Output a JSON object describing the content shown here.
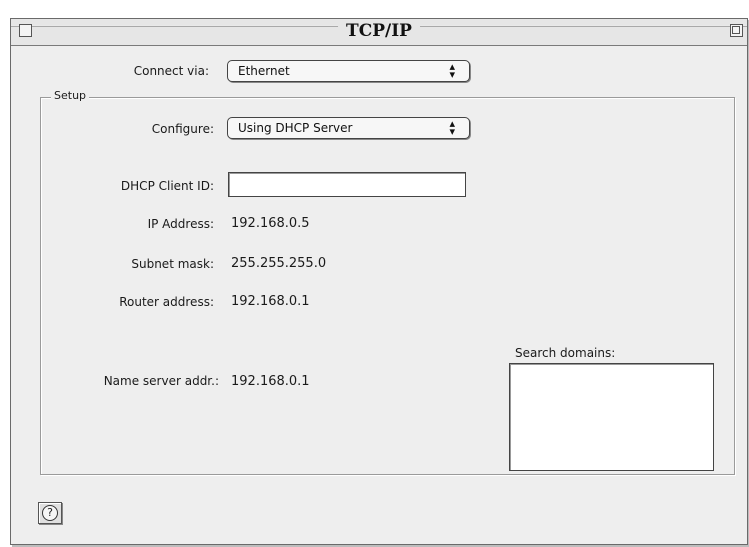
{
  "window": {
    "title": "TCP/IP"
  },
  "connect_via": {
    "label": "Connect via:",
    "selected": "Ethernet"
  },
  "setup": {
    "group_label": "Setup",
    "configure": {
      "label": "Configure:",
      "selected": "Using DHCP Server"
    },
    "dhcp_client_id": {
      "label": "DHCP Client ID:",
      "value": ""
    },
    "ip_address": {
      "label": "IP Address:",
      "value": "192.168.0.5"
    },
    "subnet_mask": {
      "label": "Subnet mask:",
      "value": "255.255.255.0"
    },
    "router_address": {
      "label": "Router address:",
      "value": "192.168.0.1"
    },
    "name_server": {
      "label": "Name server addr.:",
      "value": "192.168.0.1"
    },
    "search_domains": {
      "label": "Search domains:",
      "value": ""
    }
  },
  "help": {
    "glyph": "?",
    "icon": "help-icon"
  }
}
